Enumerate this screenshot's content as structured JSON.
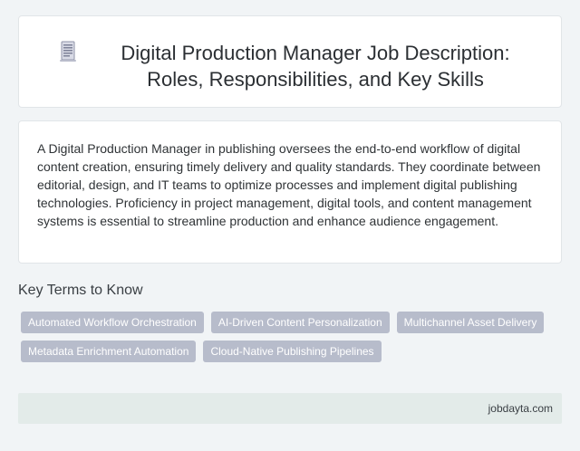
{
  "header": {
    "icon": "document-icon",
    "title_line1": "Digital Production Manager Job Description:",
    "title_line2": "Roles, Responsibilities, and Key Skills"
  },
  "description": "A Digital Production Manager in publishing oversees the end-to-end workflow of digital content creation, ensuring timely delivery and quality standards. They coordinate between editorial, design, and IT teams to optimize processes and implement digital publishing technologies. Proficiency in project management, digital tools, and content management systems is essential to streamline production and enhance audience engagement.",
  "key_terms": {
    "heading": "Key Terms to Know",
    "tags": [
      "Automated Workflow Orchestration",
      "AI-Driven Content Personalization",
      "Multichannel Asset Delivery",
      "Metadata Enrichment Automation",
      "Cloud-Native Publishing Pipelines"
    ]
  },
  "footer": {
    "site": "jobdayta.com"
  },
  "colors": {
    "page_bg": "#f1f4f6",
    "tag_bg": "#b7bccb",
    "footer_bg": "#e3ebe9"
  }
}
